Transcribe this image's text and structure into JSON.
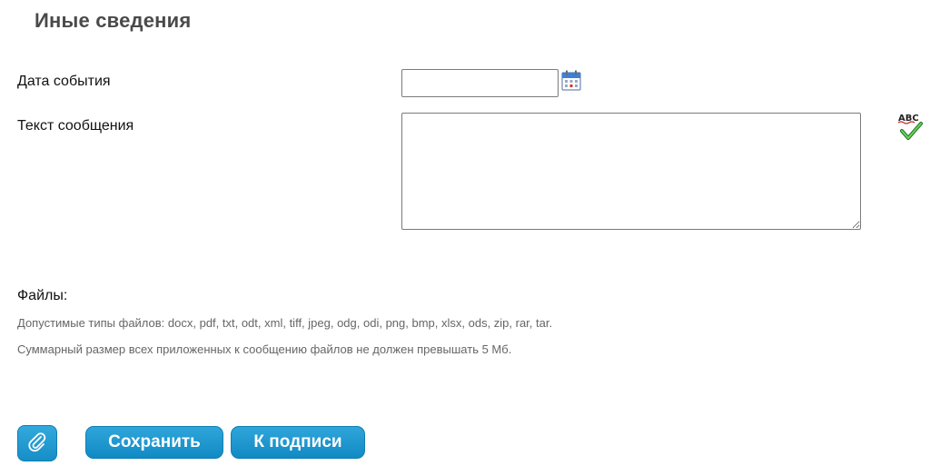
{
  "section": {
    "title": "Иные сведения"
  },
  "fields": {
    "event_date": {
      "label": "Дата события",
      "value": "",
      "calendar_icon": "calendar-icon"
    },
    "message_text": {
      "label": "Текст сообщения",
      "value": "",
      "spellcheck_icon": "spellcheck-icon"
    }
  },
  "files": {
    "label": "Файлы:",
    "allowed_types_hint": "Допустимые типы файлов: docx, pdf, txt, odt, xml, tiff, jpeg, odg, odi, png, bmp, xlsx, ods, zip, rar, tar.",
    "size_hint": "Суммарный размер всех приложенных к сообщению файлов не должен превышать 5 Мб."
  },
  "actions": {
    "attach_icon": "paperclip-icon",
    "save_label": "Сохранить",
    "sign_label": "К подписи"
  },
  "colors": {
    "button_primary": "#1a96d0",
    "title_gray": "#4a4a4a",
    "hint_gray": "#666666"
  }
}
